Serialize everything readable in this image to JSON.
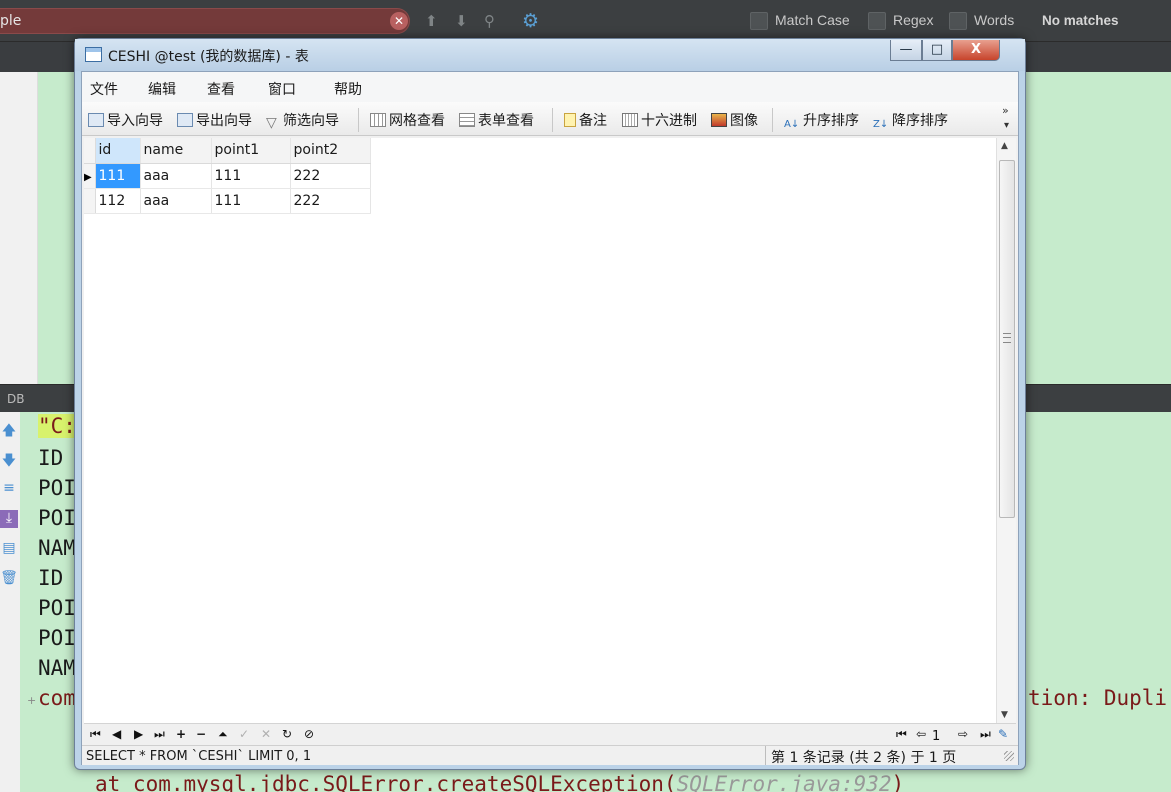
{
  "ide": {
    "find_text": "ple",
    "find_options": [
      {
        "label": "Match Case"
      },
      {
        "label": "Regex"
      },
      {
        "label": "Words"
      }
    ],
    "find_status": "No matches",
    "panel_title": "DB",
    "console": {
      "first": "\"C:",
      "lines": [
        "ID",
        "POI",
        "POI",
        "NAM",
        "ID",
        "POI",
        "POI",
        "NAM"
      ],
      "error_left": "com",
      "error_right": "tion: Dupli",
      "stack_call": "at com.mysql.jdbc.SQLError.createSQLException(",
      "stack_src": "SQLError.java:932",
      "stack_end": ")"
    }
  },
  "window": {
    "title": "CESHI @test (我的数据库) - 表",
    "buttons": {
      "minimize": "—",
      "maximize": "□",
      "close": "X"
    },
    "menu": [
      "文件",
      "编辑",
      "查看",
      "窗口",
      "帮助"
    ],
    "toolbar": [
      "导入向导",
      "导出向导",
      "筛选向导",
      "网格查看",
      "表单查看",
      "备注",
      "十六进制",
      "图像",
      "升序排序",
      "降序排序"
    ],
    "toolbar_more": "»"
  },
  "table": {
    "columns": [
      "id",
      "name",
      "point1",
      "point2"
    ],
    "rows": [
      [
        "111",
        "aaa",
        "111",
        "222"
      ],
      [
        "112",
        "aaa",
        "111",
        "222"
      ]
    ],
    "selected_row": 0,
    "selected_col": 0
  },
  "navigator": {
    "buttons": [
      "first-record",
      "prev-record",
      "next-record",
      "last-record",
      "add-record",
      "delete-record",
      "move-up",
      "apply",
      "cancel",
      "refresh",
      "stop"
    ],
    "page": "1"
  },
  "status": {
    "sql": "SELECT * FROM `CESHI` LIMIT 0, 1",
    "records": "第 1 条记录 (共 2 条) 于 1 页"
  },
  "colors": {
    "selection": "#3399ff",
    "console_bg": "#c6ebcc",
    "error_text": "#7a1a1a",
    "find_bg_error": "#743a3a"
  }
}
